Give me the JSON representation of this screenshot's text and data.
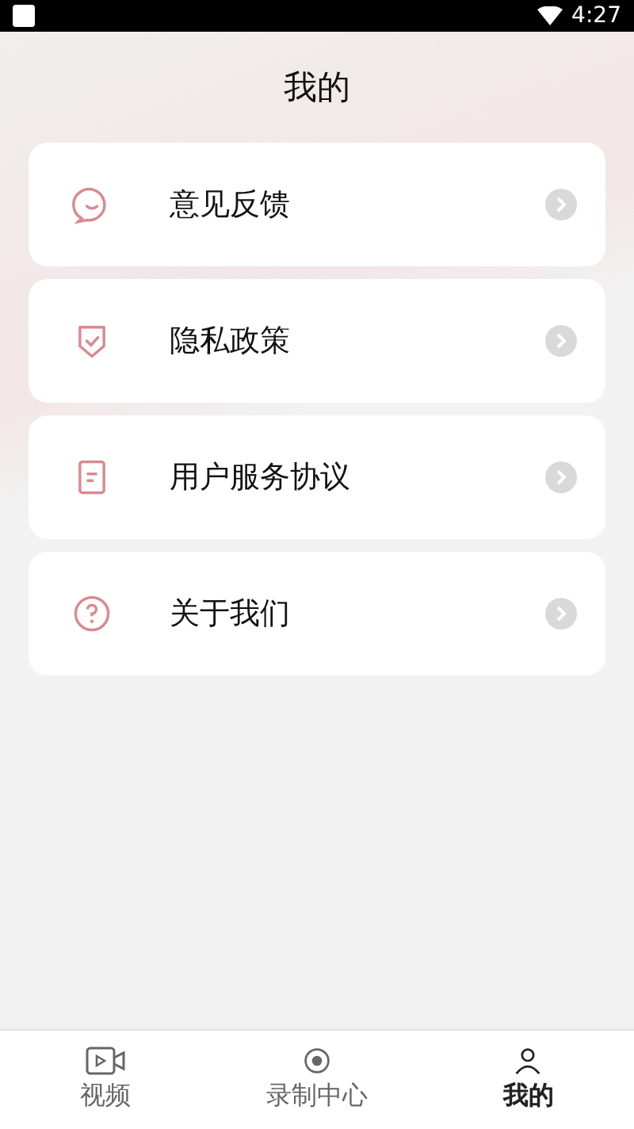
{
  "status_bar": {
    "time": "4:27"
  },
  "header": {
    "title": "我的"
  },
  "menu_items": [
    {
      "label": "意见反馈",
      "kind": "feedback"
    },
    {
      "label": "隐私政策",
      "kind": "shield"
    },
    {
      "label": "用户服务协议",
      "kind": "document"
    },
    {
      "label": "关于我们",
      "kind": "help"
    }
  ],
  "tab_bar": [
    {
      "label": "视频",
      "kind": "video",
      "selected": false
    },
    {
      "label": "录制中心",
      "kind": "record",
      "selected": false
    },
    {
      "label": "我的",
      "kind": "person",
      "selected": true
    }
  ]
}
